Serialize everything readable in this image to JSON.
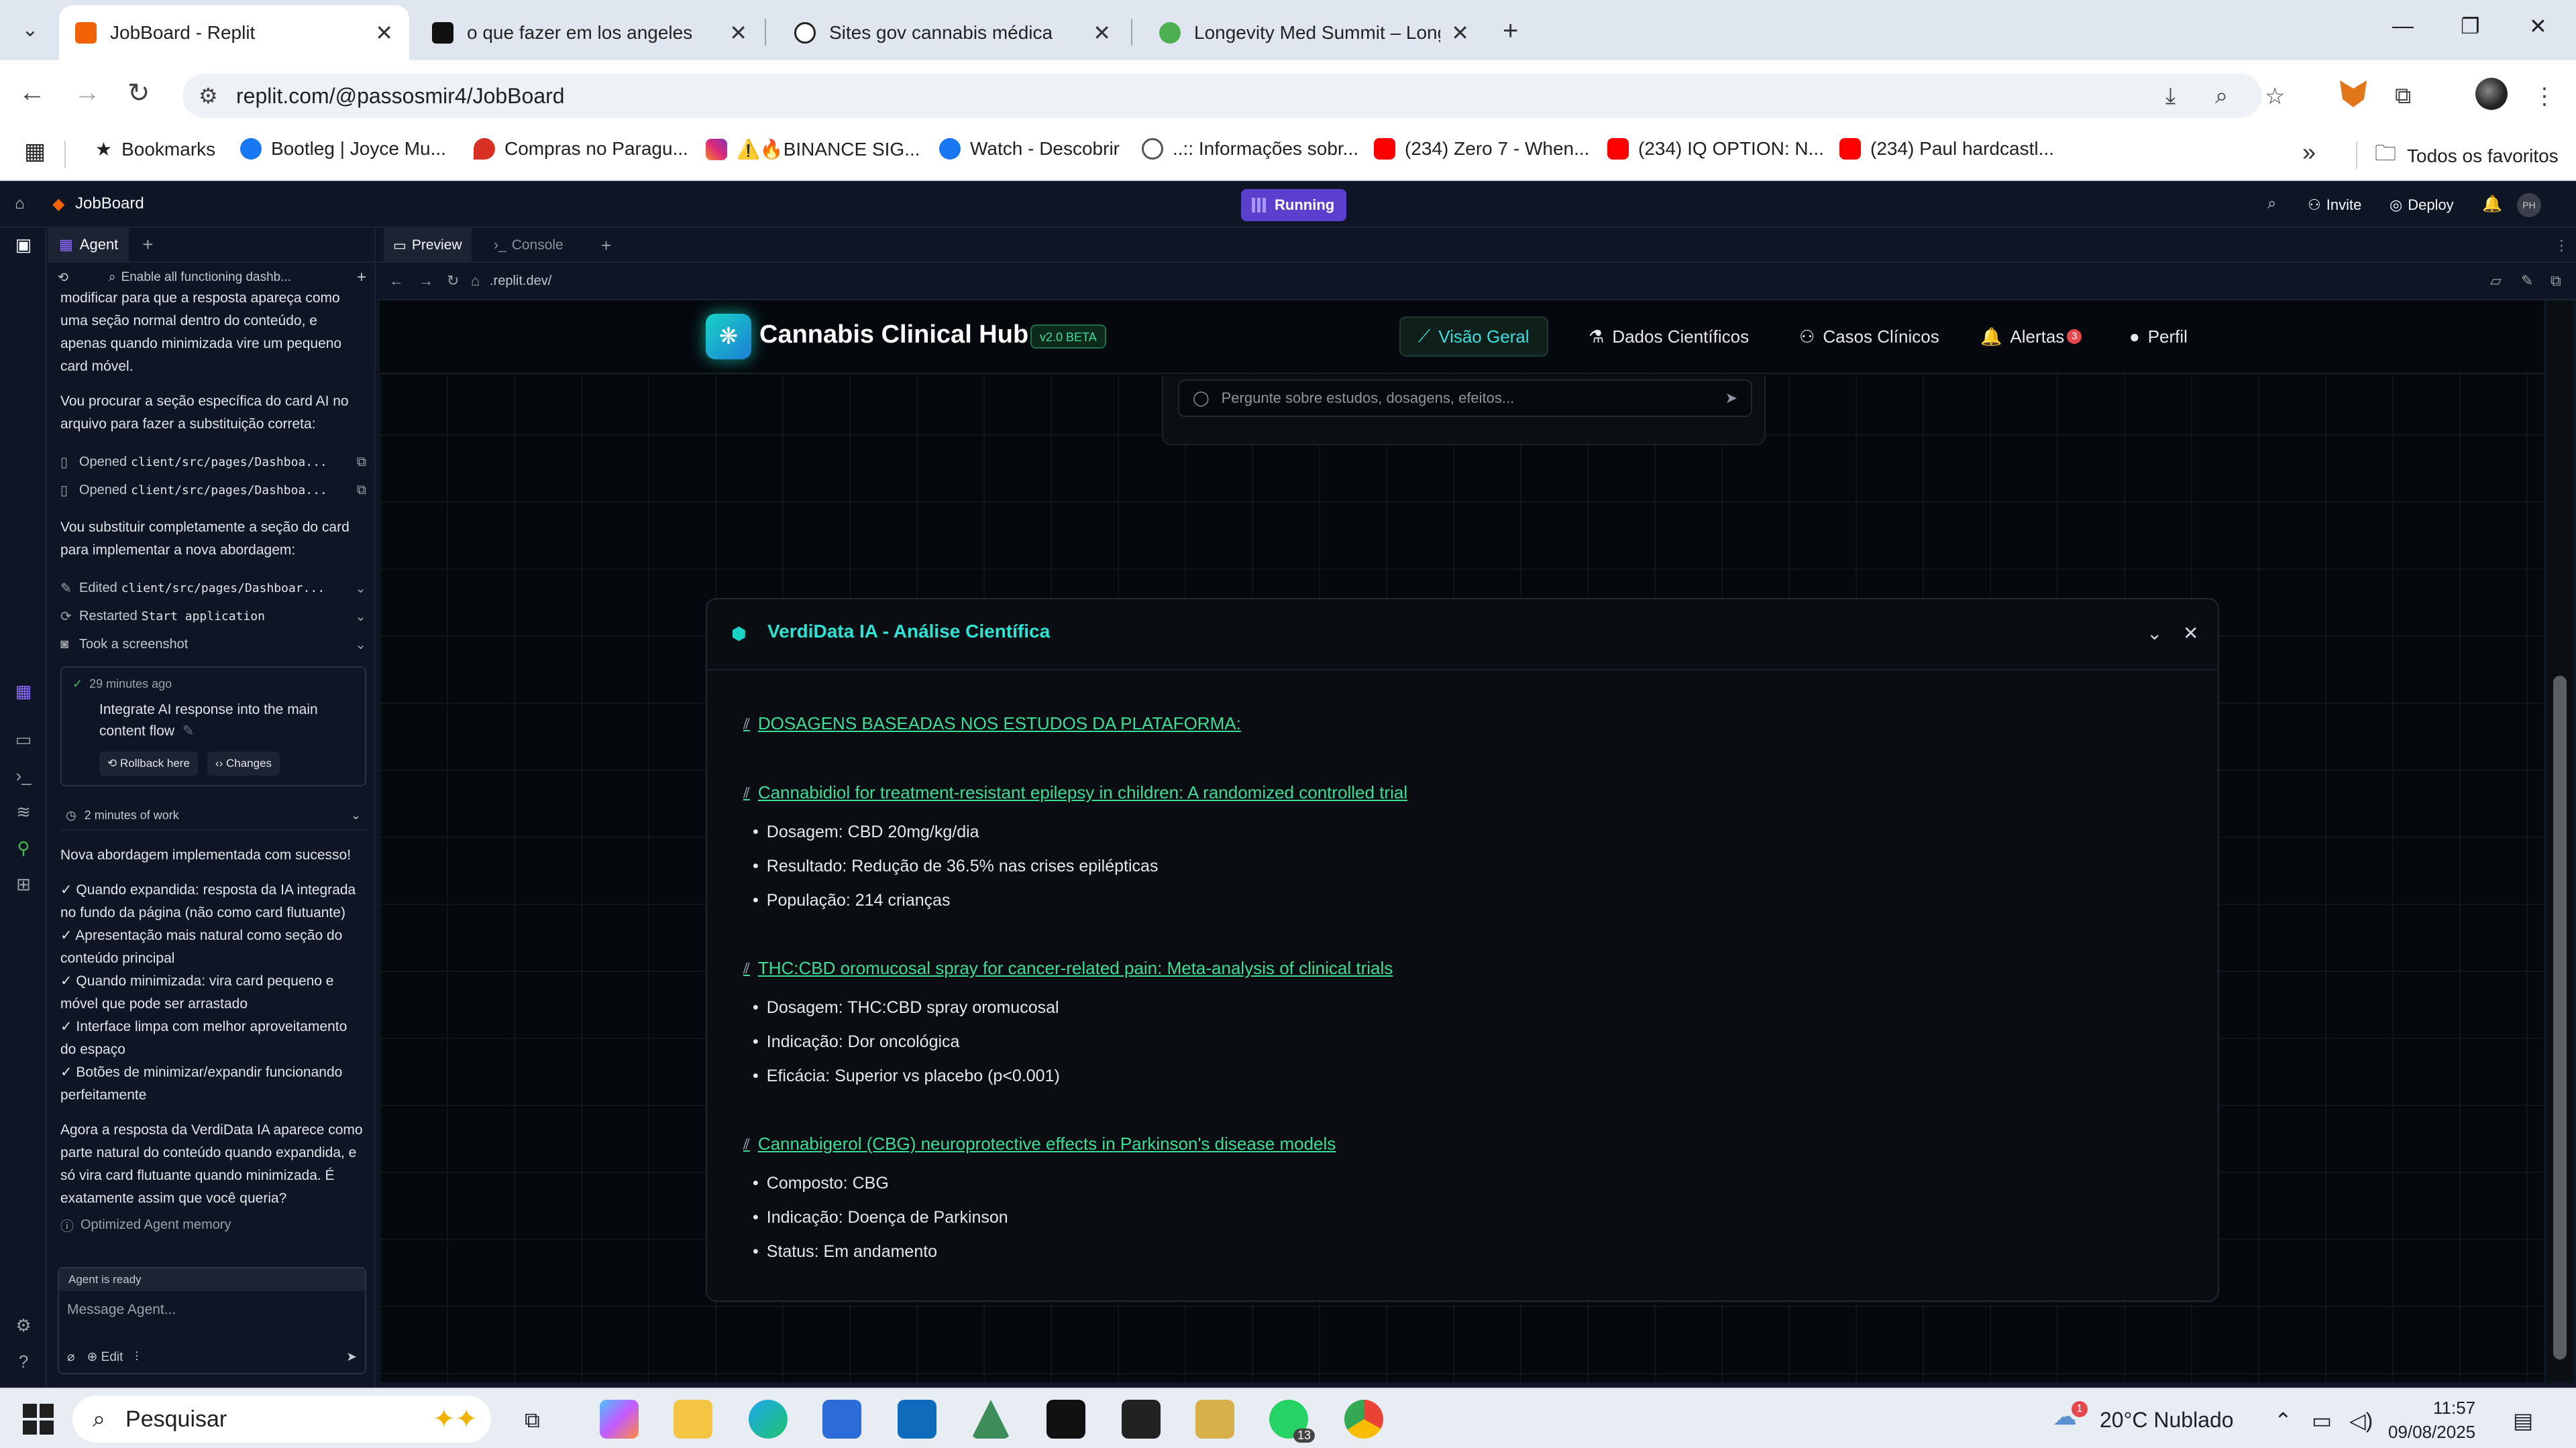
{
  "browser": {
    "tabs": [
      {
        "title": "JobBoard - Replit",
        "active": true
      },
      {
        "title": "o que fazer em los angeles",
        "active": false
      },
      {
        "title": "Sites gov cannabis médica",
        "active": false
      },
      {
        "title": "Longevity Med Summit – Longe",
        "active": false
      }
    ],
    "url": "replit.com/@passosmir4/JobBoard",
    "bookmarks": [
      "Bookmarks",
      "Bootleg | Joyce Mu...",
      "Compras no Paragu...",
      "⚠️🔥BINANCE SIG...",
      "Watch - Descobrir",
      "..:: Informações sobr...",
      "(234) Zero 7 - When...",
      "(234) IQ OPTION: N...",
      "(234) Paul hardcastl..."
    ],
    "all_bookmarks": "Todos os favoritos"
  },
  "replit": {
    "project": "JobBoard",
    "status": "Running",
    "invite": "Invite",
    "deploy": "Deploy",
    "avatar": "PH"
  },
  "agent": {
    "tab_label": "Agent",
    "subheader": "Enable all functioning dashb...",
    "intro": "modificar para que a resposta apareça como uma seção normal dentro do conteúdo, e apenas quando minimizada vire um pequeno card móvel.",
    "p_search": "Vou procurar a seção específica do card AI no arquivo para fazer a substituição correta:",
    "opened_1_label": "Opened",
    "opened_1_path": "client/src/pages/Dashboa...",
    "opened_2_label": "Opened",
    "opened_2_path": "client/src/pages/Dashboa...",
    "p_replace": "Vou substituir completamente a seção do card para implementar a nova abordagem:",
    "edited_label": "Edited",
    "edited_path": "client/src/pages/Dashboar...",
    "restarted_label": "Restarted",
    "restarted_path": "Start application",
    "screenshot_label": "Took a screenshot",
    "checkpoint_time": "29 minutes ago",
    "checkpoint_text": "Integrate AI response into the main content flow",
    "rollback": "Rollback here",
    "changes": "Changes",
    "work_time": "2 minutes of work",
    "success": "Nova abordagem implementada com sucesso!",
    "checks": [
      "✓ Quando expandida: resposta da IA integrada no fundo da página (não como card flutuante)",
      "✓ Apresentação mais natural como seção do conteúdo principal",
      "✓ Quando minimizada: vira card pequeno e móvel que pode ser arrastado",
      "✓ Interface limpa com melhor aproveitamento do espaço",
      "✓ Botões de minimizar/expandir funcionando perfeitamente"
    ],
    "closing": "Agora a resposta da VerdiData IA aparece como parte natural do conteúdo quando expandida, e só vira card flutuante quando minimizada. É exatamente assim que você queria?",
    "memory": "Optimized Agent memory",
    "ready": "Agent is ready",
    "placeholder": "Message Agent...",
    "edit": "Edit"
  },
  "preview": {
    "tab_preview": "Preview",
    "tab_console": "Console",
    "address": ".replit.dev/"
  },
  "app": {
    "brand": "Cannabis Clinical Hub",
    "version": "v2.0 BETA",
    "nav": [
      {
        "label": "Visão Geral",
        "icon": "chart-icon",
        "active": true
      },
      {
        "label": "Dados Científicos",
        "icon": "flask-icon",
        "active": false
      },
      {
        "label": "Casos Clínicos",
        "icon": "user-icon",
        "active": false
      },
      {
        "label": "Alertas",
        "icon": "bell-icon",
        "active": false,
        "badge": "3"
      },
      {
        "label": "Perfil",
        "icon": "profile-icon",
        "active": false
      }
    ],
    "ask_placeholder": "Pergunte sobre estudos, dosagens, efeitos...",
    "ai_card": {
      "title": "VerdiData IA - Análise Científica",
      "heading": "DOSAGENS BASEADAS NOS ESTUDOS DA PLATAFORMA:",
      "studies": [
        {
          "title": "Cannabidiol for treatment-resistant epilepsy in children: A randomized controlled trial",
          "items": [
            "Dosagem: CBD 20mg/kg/dia",
            "Resultado: Redução de 36.5% nas crises epilépticas",
            "População: 214 crianças"
          ]
        },
        {
          "title": "THC:CBD oromucosal spray for cancer-related pain: Meta-analysis of clinical trials",
          "items": [
            "Dosagem: THC:CBD spray oromucosal",
            "Indicação: Dor oncológica",
            "Eficácia: Superior vs placebo (p<0.001)"
          ]
        },
        {
          "title": "Cannabigerol (CBG) neuroprotective effects in Parkinson's disease models",
          "items": [
            "Composto: CBG",
            "Indicação: Doença de Parkinson",
            "Status: Em andamento"
          ]
        }
      ]
    }
  },
  "taskbar": {
    "search": "Pesquisar",
    "weather": "20°C  Nublado",
    "weather_badge": "1",
    "whatsapp_badge": "13",
    "time": "11:57",
    "date": "09/08/2025"
  }
}
